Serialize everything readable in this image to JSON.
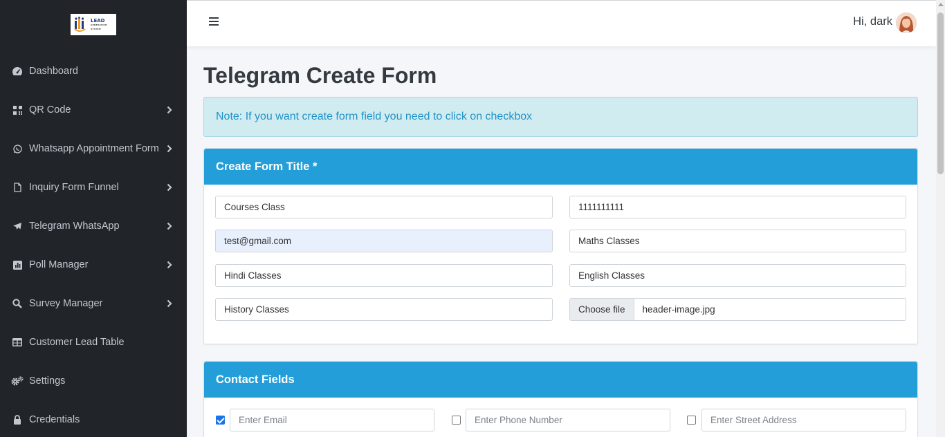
{
  "logo": {
    "line1": "LEAD",
    "line2": "GENERATION",
    "line3": "SYSTEM"
  },
  "sidebar": {
    "items": [
      {
        "label": "Dashboard",
        "icon": "dashboard-icon",
        "has_submenu": false
      },
      {
        "label": "QR Code",
        "icon": "qrcode-icon",
        "has_submenu": true
      },
      {
        "label": "Whatsapp Appointment Form",
        "icon": "whatsapp-icon",
        "has_submenu": true
      },
      {
        "label": "Inquiry Form Funnel",
        "icon": "file-icon",
        "has_submenu": true
      },
      {
        "label": "Telegram WhatsApp",
        "icon": "telegram-icon",
        "has_submenu": true
      },
      {
        "label": "Poll Manager",
        "icon": "poll-icon",
        "has_submenu": true
      },
      {
        "label": "Survey Manager",
        "icon": "search-icon",
        "has_submenu": true
      },
      {
        "label": "Customer Lead Table",
        "icon": "table-icon",
        "has_submenu": false
      },
      {
        "label": "Settings",
        "icon": "gears-icon",
        "has_submenu": false
      },
      {
        "label": "Credentials",
        "icon": "lock-icon",
        "has_submenu": false
      }
    ]
  },
  "header": {
    "greeting": "Hi, dark"
  },
  "main": {
    "title": "Telegram Create Form",
    "note": "Note: If you want create form field you need to click on checkbox",
    "form_title_card": {
      "heading": "Create Form Title *",
      "fields": {
        "course": "Courses Class",
        "phone": "1111111111",
        "email": "test@gmail.com",
        "maths": "Maths Classes",
        "hindi": "Hindi Classes",
        "english": "English Classes",
        "history": "History Classes"
      },
      "file": {
        "button": "Choose file",
        "name": "header-image.jpg"
      }
    },
    "contact_card": {
      "heading": "Contact Fields",
      "fields": [
        {
          "placeholder": "Enter Email",
          "checked": true
        },
        {
          "placeholder": "Enter Phone Number",
          "checked": false
        },
        {
          "placeholder": "Enter Street Address",
          "checked": false
        }
      ]
    }
  },
  "colors": {
    "sidebar_bg": "#212529",
    "accent": "#239ed8",
    "alert_bg": "#d1ecf1",
    "alert_text": "#1f93c7"
  }
}
